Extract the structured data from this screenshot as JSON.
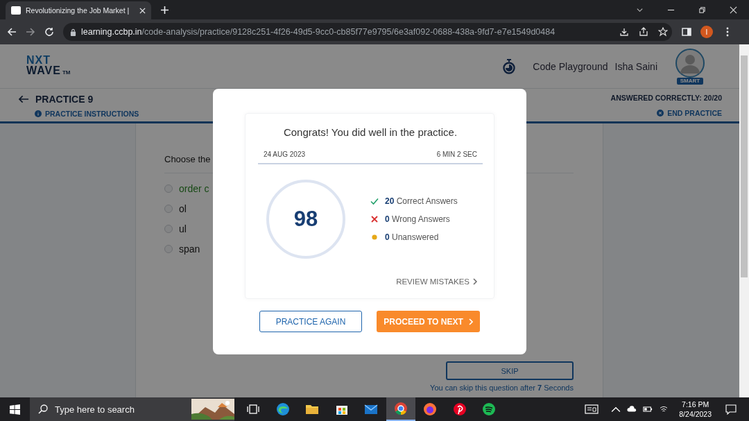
{
  "browser": {
    "tab_title": "Revolutionizing the Job Market |",
    "url_host": "learning.ccbp.in",
    "url_path": "/code-analysis/practice/9128c251-4f26-49d5-9cc0-cb85f77e9795/6e3af092-0688-438a-9fd7-e7e1549d0484",
    "profile_initial": "I"
  },
  "header": {
    "logo_lines": [
      "NXT",
      "WAVE"
    ],
    "logo_mark": "TM",
    "playground": "Code Playground",
    "user_name": "Isha Saini",
    "badge": "SMART"
  },
  "practice_bar": {
    "title": "PRACTICE 9",
    "instructions": "PRACTICE INSTRUCTIONS",
    "score": "ANSWERED CORRECTLY: 20/20",
    "end": "END PRACTICE"
  },
  "question": {
    "text": "Choose the",
    "options": [
      {
        "label": "order c",
        "highlighted": true,
        "selected": false
      },
      {
        "label": "ol",
        "highlighted": false,
        "selected": false
      },
      {
        "label": "ul",
        "highlighted": false,
        "selected": false
      },
      {
        "label": "span",
        "highlighted": false,
        "selected": false
      }
    ],
    "skip": "SKIP",
    "skip_hint": "You can skip this question after **7** Seconds"
  },
  "modal": {
    "title": "Congrats! You did well in the practice.",
    "date": "24 AUG 2023",
    "duration": "6 MIN 2 SEC",
    "score": "98",
    "stats": [
      {
        "kind": "correct",
        "count": "20",
        "label": "Correct Answers"
      },
      {
        "kind": "wrong",
        "count": "0",
        "label": "Wrong Answers"
      },
      {
        "kind": "unanswered",
        "count": "0",
        "label": "Unanswered"
      }
    ],
    "review": "REVIEW MISTAKES",
    "secondary_button": "PRACTICE AGAIN",
    "primary_button": "PROCEED TO NEXT"
  },
  "taskbar": {
    "search_placeholder": "Type here to search",
    "apps": [
      {
        "kind": "taskview",
        "selected": false
      },
      {
        "kind": "edge",
        "selected": false
      },
      {
        "kind": "folder",
        "selected": false
      },
      {
        "kind": "store",
        "selected": false
      },
      {
        "kind": "mail",
        "selected": false
      },
      {
        "kind": "chrome",
        "selected": true
      },
      {
        "kind": "firefox",
        "selected": false
      },
      {
        "kind": "pinterest",
        "selected": false
      },
      {
        "kind": "spotify",
        "selected": false
      }
    ],
    "time": "7:16 PM",
    "date": "8/24/2023"
  }
}
